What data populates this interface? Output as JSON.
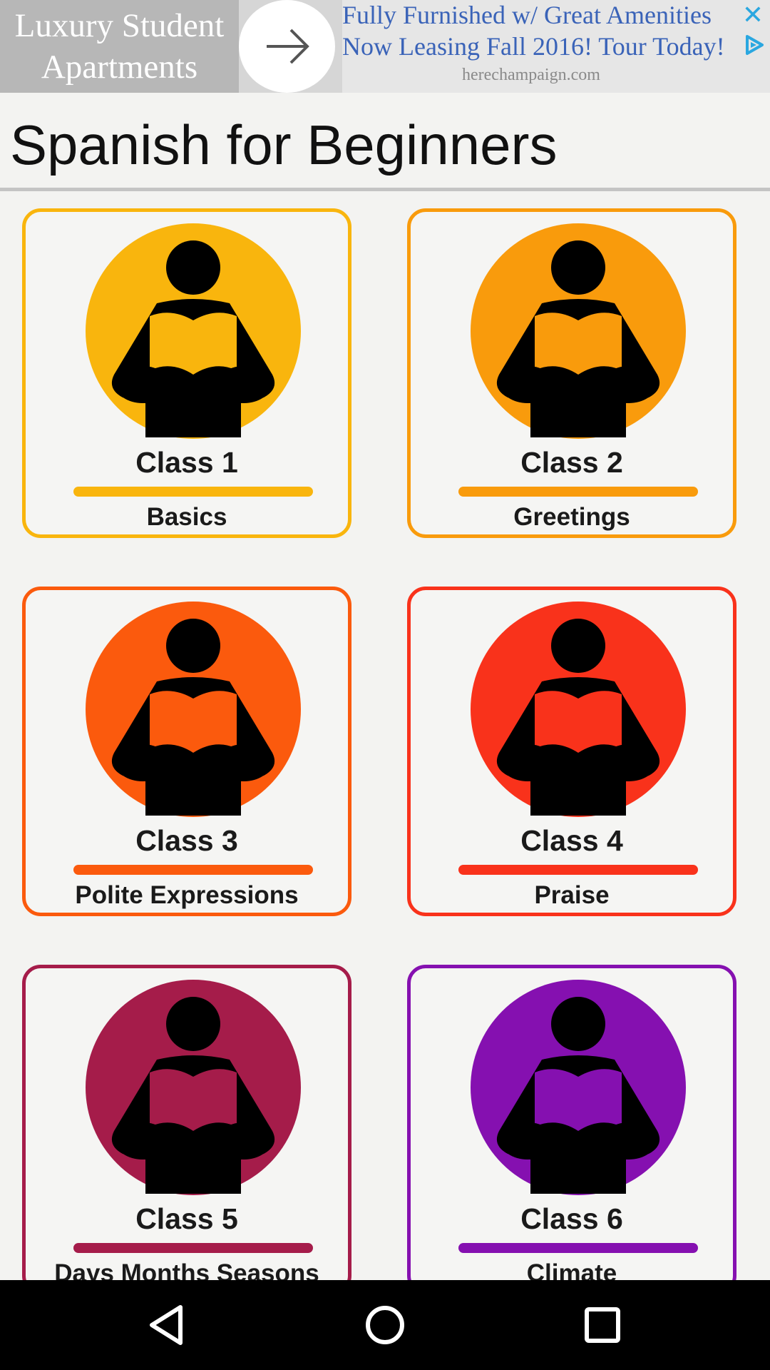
{
  "ad": {
    "left_line_1": "Luxury Student",
    "left_line_2": "Apartments",
    "right_line_1": "Fully Furnished w/ Great Amenities",
    "right_line_2": "Now Leasing Fall 2016! Tour Today!",
    "domain": "herechampaign.com",
    "close_glyph": "✕"
  },
  "header": {
    "title": "Spanish for Beginners"
  },
  "classes": [
    {
      "label": "Class 1",
      "topic": "Basics",
      "color": "#f9b50d"
    },
    {
      "label": "Class 2",
      "topic": "Greetings",
      "color": "#f99b0c"
    },
    {
      "label": "Class 3",
      "topic": "Polite Expressions",
      "color": "#fb5a0d"
    },
    {
      "label": "Class 4",
      "topic": "Praise",
      "color": "#f9321b"
    },
    {
      "label": "Class 5",
      "topic": "Days Months Seasons",
      "color": "#a51c4a"
    },
    {
      "label": "Class 6",
      "topic": "Climate",
      "color": "#8510b0"
    }
  ],
  "icons": {
    "class_icon": "reading-person-icon",
    "nav_back": "back-triangle-icon",
    "nav_home": "home-circle-icon",
    "nav_recents": "recents-square-icon"
  }
}
